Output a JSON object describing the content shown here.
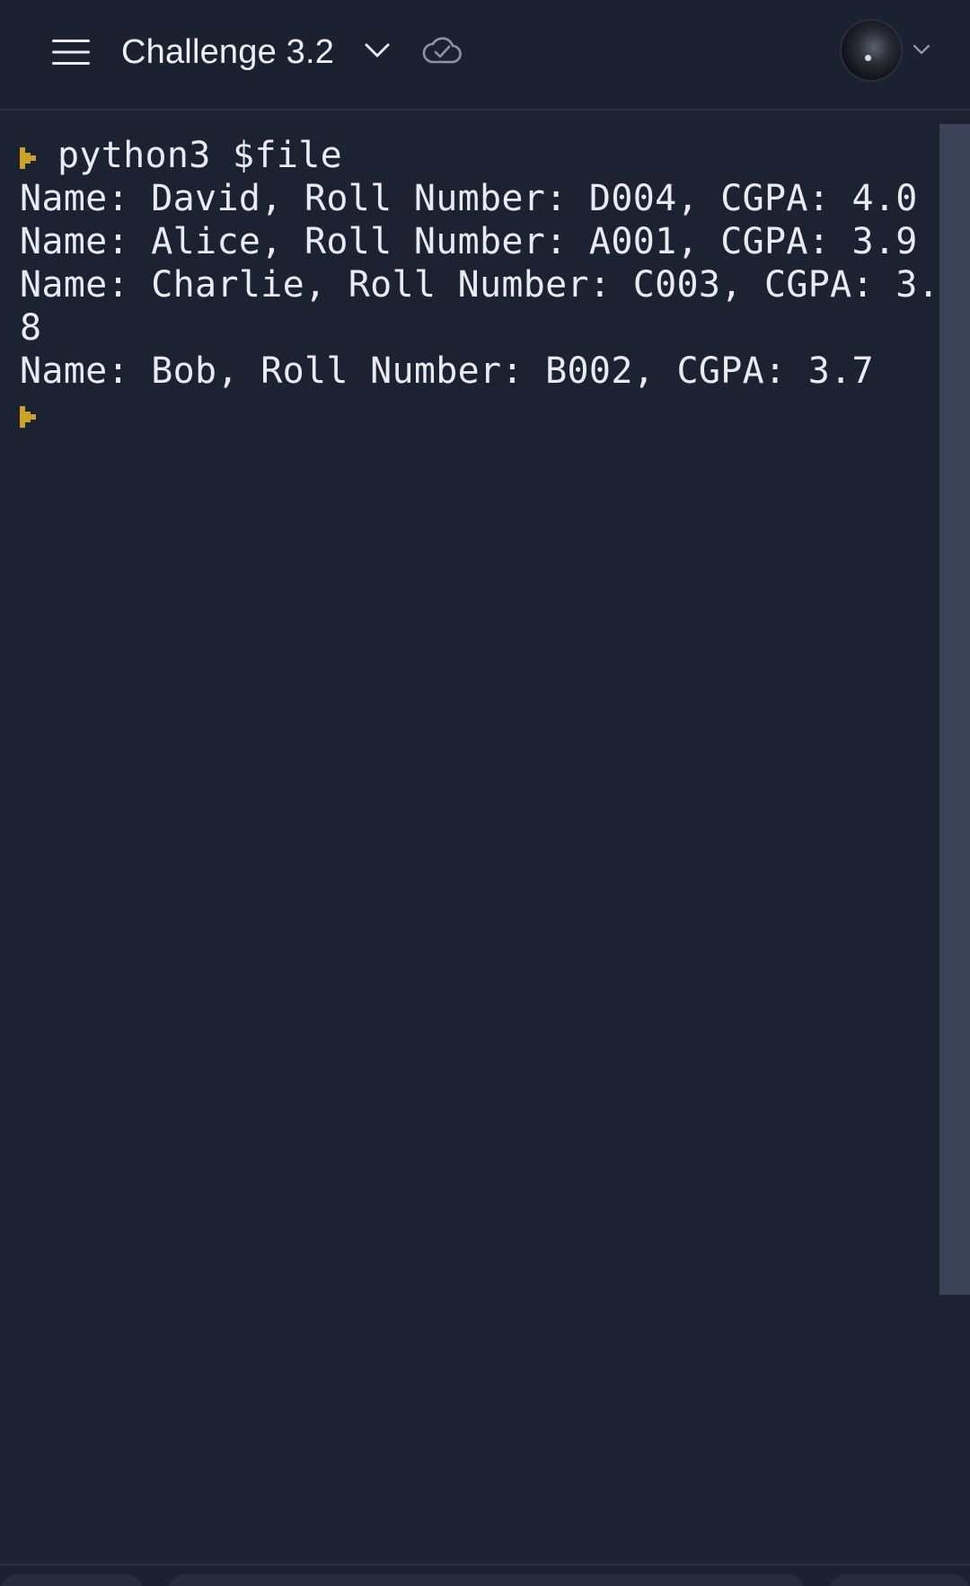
{
  "header": {
    "title": "Challenge 3.2",
    "menu_icon": "hamburger-menu-icon",
    "dropdown_icon": "chevron-down-icon",
    "sync_icon": "cloud-check-icon",
    "avatar_icon": "user-avatar",
    "avatar_dropdown_icon": "chevron-down-icon"
  },
  "terminal": {
    "command": "python3 $file",
    "prompt_color": "#c9a227",
    "output_lines": [
      "Name: David, Roll Number: D004, CGPA: 4.0",
      "Name: Alice, Roll Number: A001, CGPA: 3.9",
      "Name: Charlie, Roll Number: C003, CGPA: 3.",
      "8",
      "Name: Bob, Roll Number: B002, CGPA: 3.7"
    ]
  },
  "colors": {
    "background": "#1d2232",
    "header_background": "#1c2131",
    "text": "#e9ebf0",
    "scrollbar": "#3b4358",
    "prompt_accent": "#c9a227"
  }
}
